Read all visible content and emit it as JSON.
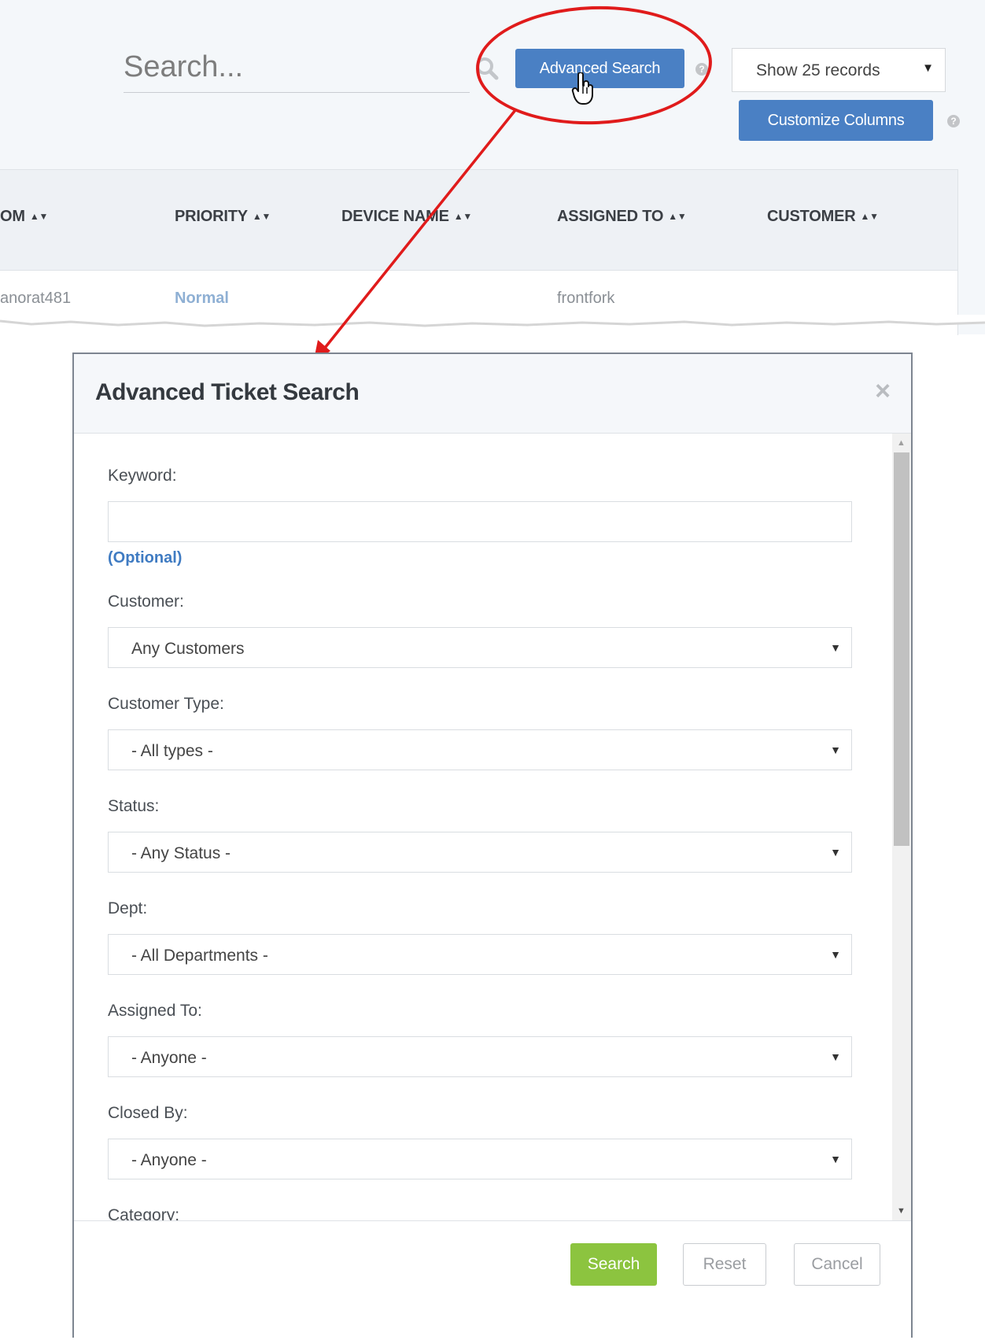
{
  "toolbar": {
    "search_placeholder": "Search...",
    "advanced_search_label": "Advanced Search",
    "records_select_value": "Show 25 records",
    "customize_columns_label": "Customize Columns",
    "help_glyph": "?"
  },
  "table": {
    "columns": [
      "OM",
      "PRIORITY",
      "DEVICE NAME",
      "ASSIGNED TO",
      "CUSTOMER"
    ],
    "row": {
      "from": "anorat481",
      "priority": "Normal",
      "device_name": "",
      "assigned_to": "frontfork",
      "customer": ""
    }
  },
  "modal": {
    "title": "Advanced Ticket Search",
    "close_glyph": "×",
    "keyword_label": "Keyword:",
    "keyword_value": "",
    "optional_hint": "(Optional)",
    "customer_label": "Customer:",
    "customer_value": "Any Customers",
    "customer_type_label": "Customer Type:",
    "customer_type_value": "- All types -",
    "status_label": "Status:",
    "status_value": "- Any Status -",
    "dept_label": "Dept:",
    "dept_value": "- All Departments -",
    "assigned_to_label": "Assigned To:",
    "assigned_to_value": "- Anyone -",
    "closed_by_label": "Closed By:",
    "closed_by_value": "- Anyone -",
    "category_label": "Category:",
    "search_btn": "Search",
    "reset_btn": "Reset",
    "cancel_btn": "Cancel"
  },
  "icons": {
    "search_icon": "search-icon",
    "help_icon": "help-icon",
    "dropdown_icon": "chevron-down-icon",
    "close_icon": "close-icon",
    "hand_cursor": "hand-pointer-icon"
  },
  "colors": {
    "primary_blue": "#4a80c4",
    "success_green": "#8cc43f",
    "callout_red": "#e01b1b",
    "link_blue": "#3f7bc2"
  }
}
